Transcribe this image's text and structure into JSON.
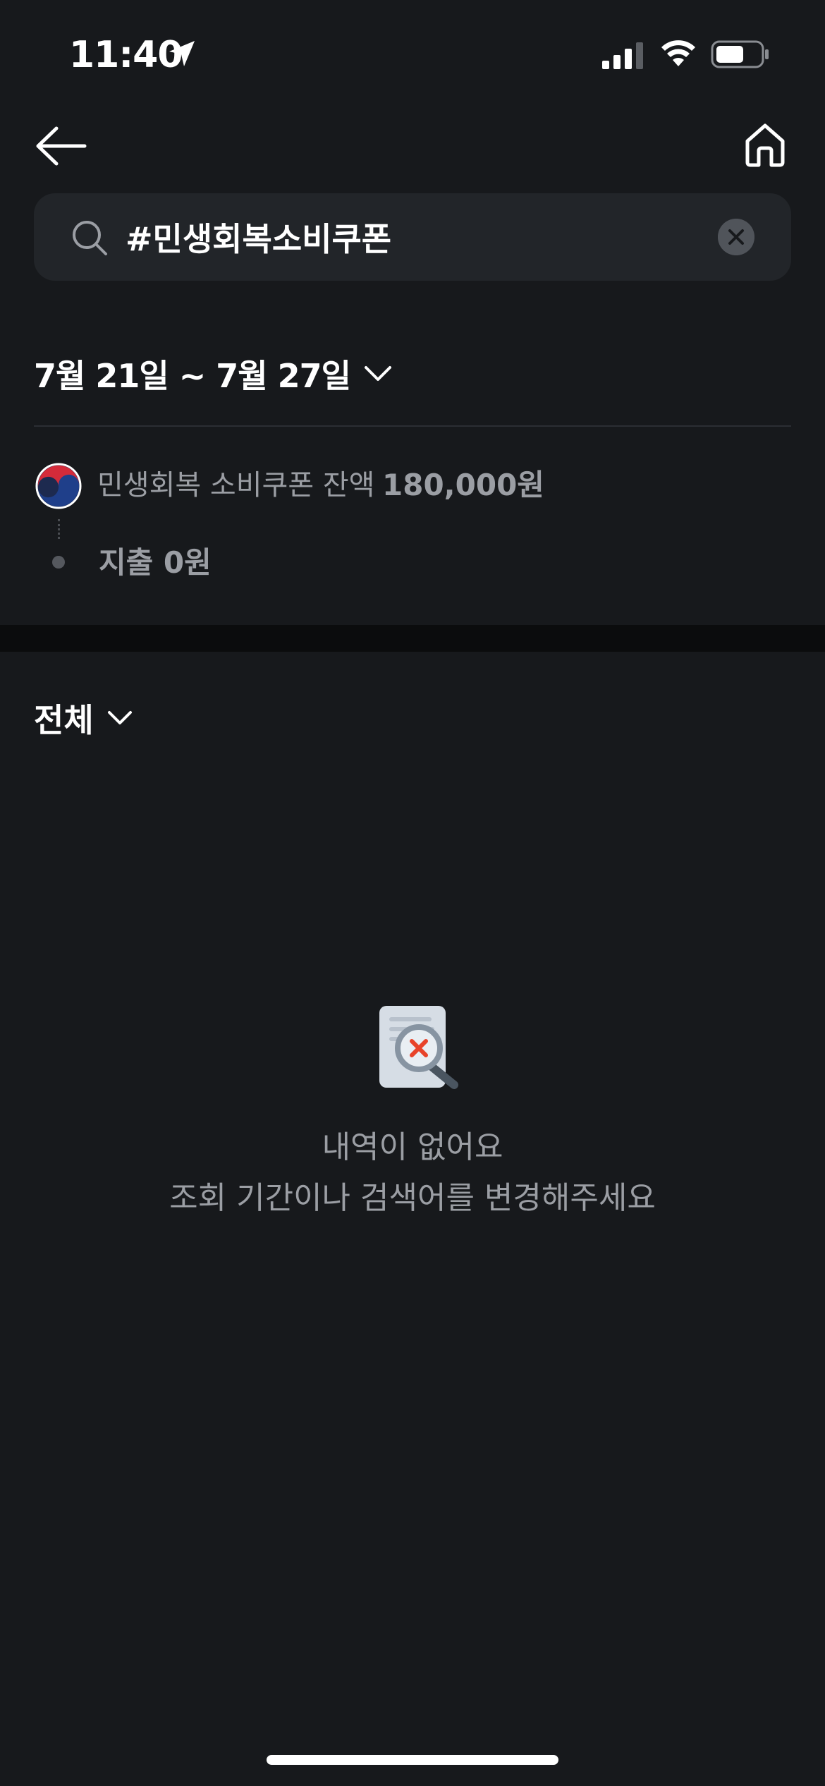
{
  "status_bar": {
    "time": "11:40",
    "icons": [
      "location-arrow-icon",
      "signal-icon",
      "wifi-icon",
      "battery-icon"
    ]
  },
  "nav": {
    "icons": [
      "back-arrow-icon",
      "home-icon"
    ]
  },
  "search": {
    "value": "#민생회복소비쿠폰",
    "icons": [
      "search-icon",
      "clear-icon"
    ]
  },
  "date_range": {
    "label": "7월 21일 ~ 7월 27일"
  },
  "coupon": {
    "label": "민생회복 소비쿠폰 잔액",
    "balance": "180,000원",
    "spending": "지출 0원"
  },
  "filter": {
    "label": "전체"
  },
  "empty_state": {
    "title": "내역이 없어요",
    "subtitle": "조회 기간이나 검색어를 변경해주세요",
    "icon": "document-search-empty-icon"
  },
  "colors": {
    "background": "#17191c",
    "search_bg": "#222529",
    "secondary_text": "#9b9ea4",
    "accent_red": "#e8432a"
  }
}
